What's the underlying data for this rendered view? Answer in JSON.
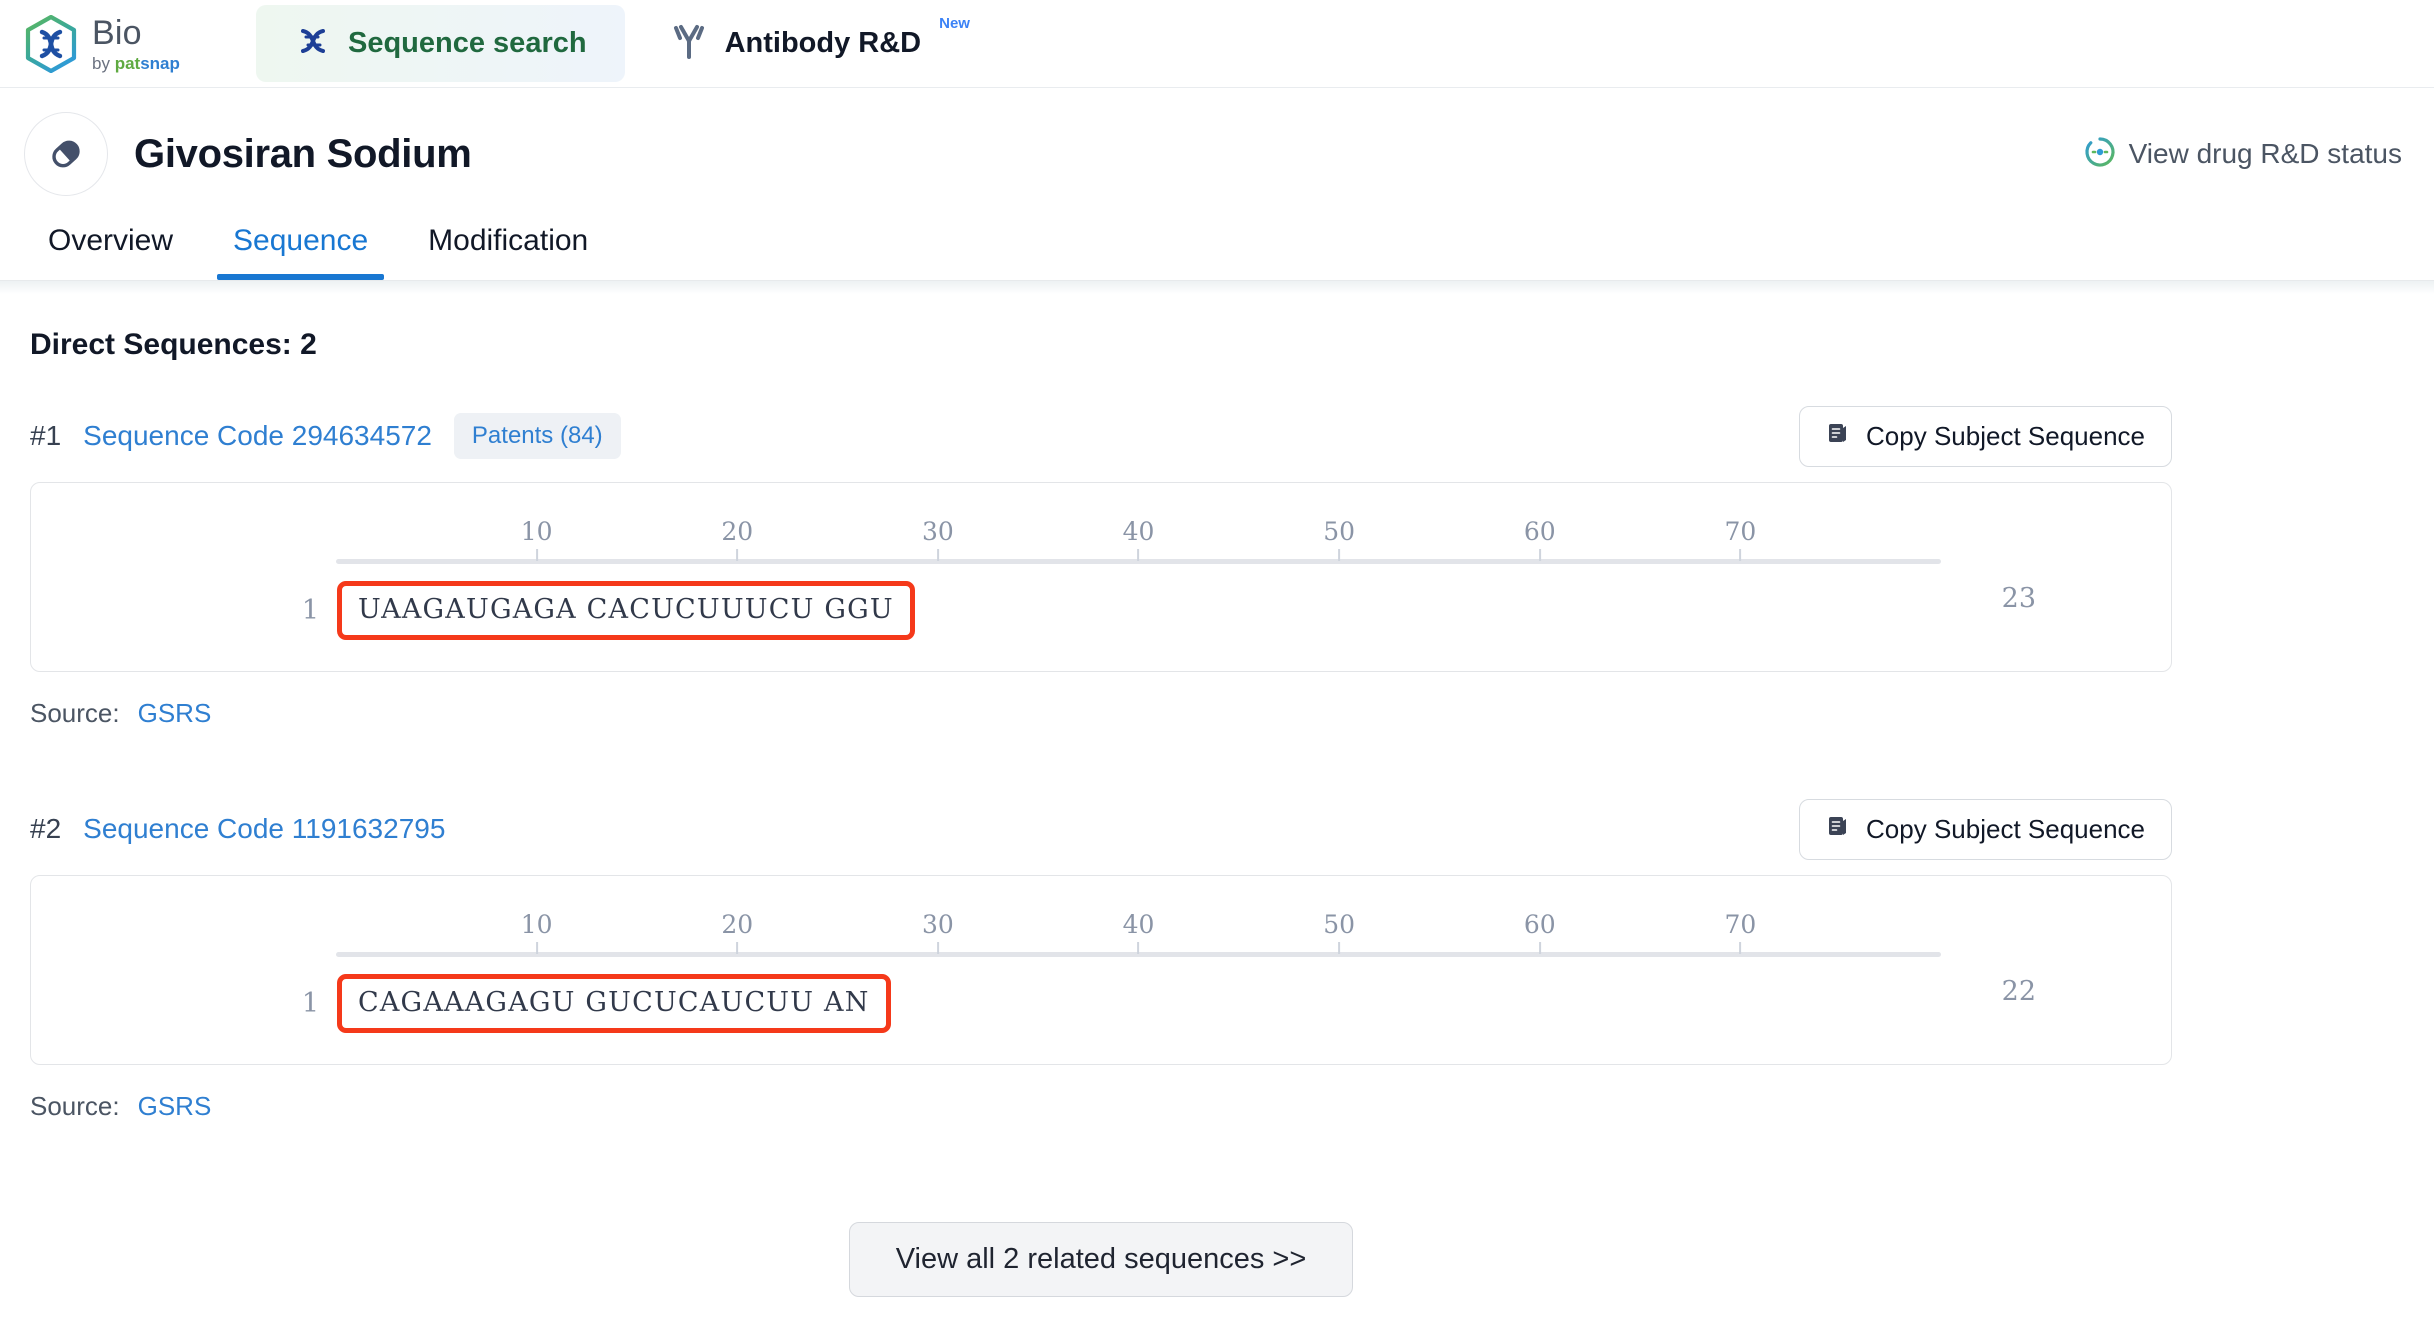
{
  "topnav": {
    "brand": {
      "title": "Bio",
      "by": "by ",
      "pat": "pat",
      "snap": "snap",
      "logo_icon": "dna-hex-logo-icon"
    },
    "tabs": [
      {
        "label": "Sequence search",
        "icon": "dna-icon",
        "active": true,
        "badge": ""
      },
      {
        "label": "Antibody R&D",
        "icon": "antibody-icon",
        "active": false,
        "badge": "New"
      }
    ]
  },
  "drug_header": {
    "avatar_icon": "capsule-pill-icon",
    "title": "Givosiran Sodium",
    "rd_status": {
      "label": "View drug R&D status",
      "icon": "rd-status-icon"
    }
  },
  "tabstrip": {
    "tabs": [
      {
        "label": "Overview",
        "active": false
      },
      {
        "label": "Sequence",
        "active": true
      },
      {
        "label": "Modification",
        "active": false
      }
    ]
  },
  "main": {
    "section_title": "Direct Sequences: 2",
    "copy_button_label": "Copy Subject Sequence",
    "copy_button_icon": "copy-icon",
    "source_label": "Source:",
    "ruler_ticks": [
      "10",
      "20",
      "30",
      "40",
      "50",
      "60",
      "70"
    ],
    "ruler_max": 80,
    "sequences": [
      {
        "index": "#1",
        "code_label": "Sequence Code 294634572",
        "patents_label": "Patents (84)",
        "has_patents": true,
        "start_pos": "1",
        "end_pos": "23",
        "residues": "UAAGAUGAGA CACUCUUUCU GGU",
        "source": "GSRS"
      },
      {
        "index": "#2",
        "code_label": "Sequence Code 1191632795",
        "patents_label": "",
        "has_patents": false,
        "start_pos": "1",
        "end_pos": "22",
        "residues": "CAGAAAGAGU GUCUCAUCUU AN",
        "source": "GSRS"
      }
    ],
    "view_all_label": "View all 2 related sequences >>"
  },
  "colors": {
    "accent_blue": "#2f7fd1",
    "tab_active_blue": "#1877d2",
    "highlight_red": "#f5391a",
    "green": "#20693f"
  }
}
